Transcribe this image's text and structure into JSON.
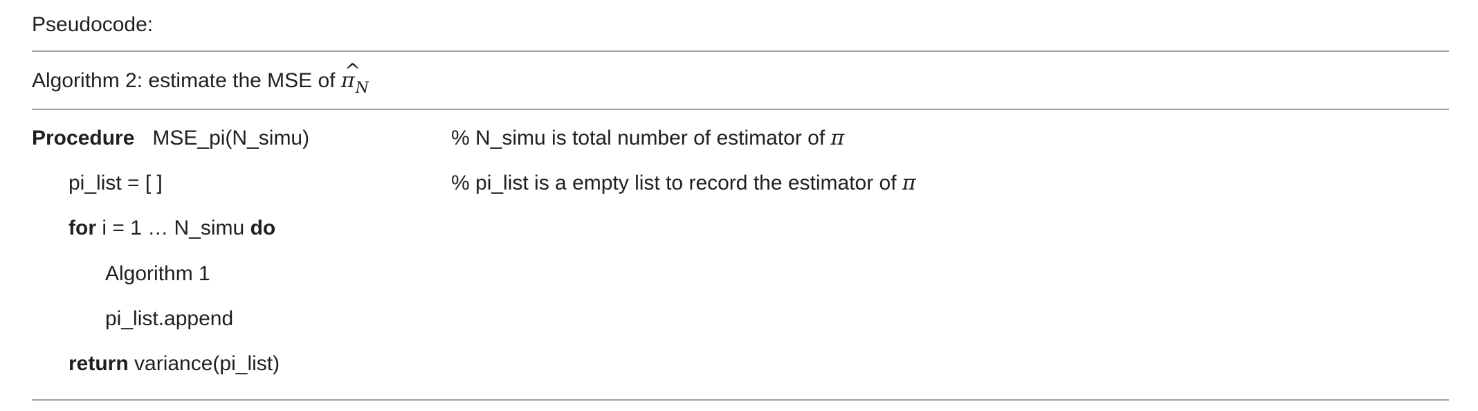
{
  "heading": "Pseudocode:",
  "algorithm": {
    "title_prefix": "Algorithm 2: estimate the MSE of ",
    "title_symbol_hat": "^",
    "title_symbol": "π",
    "title_symbol_sub": "N"
  },
  "code": {
    "procedure_keyword": "Procedure",
    "procedure_signature": "MSE_pi(N_simu)",
    "procedure_comment": "% N_simu is total number of estimator of ",
    "procedure_comment_symbol": "π",
    "init_stmt": "pi_list = [ ]",
    "init_comment": "% pi_list is a empty list to record the estimator of ",
    "init_comment_symbol": "π",
    "for_keyword": "for",
    "for_range": " i = 1 … N_simu ",
    "do_keyword": "do",
    "body_line_1": "Algorithm 1",
    "body_line_2": "pi_list.append",
    "return_keyword": "return",
    "return_expr": " variance(pi_list)"
  }
}
